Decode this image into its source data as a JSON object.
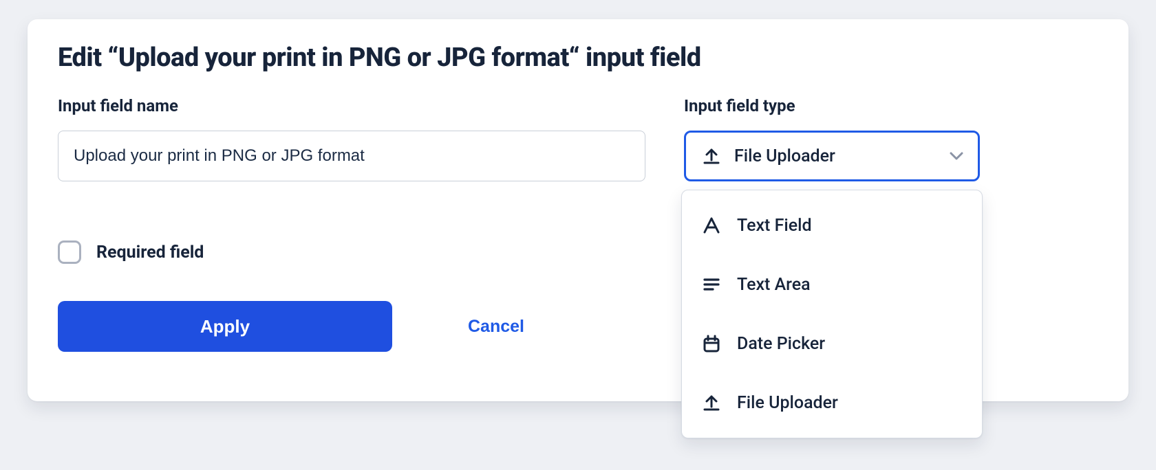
{
  "modal": {
    "title": "Edit “Upload your print in PNG or JPG format“ input field",
    "name_field": {
      "label": "Input field name",
      "value": "Upload your print in PNG or JPG format"
    },
    "type_field": {
      "label": "Input field type",
      "selected_icon": "upload-icon",
      "selected_label": "File Uploader",
      "options": [
        {
          "icon": "text-a-icon",
          "label": "Text Field"
        },
        {
          "icon": "text-lines-icon",
          "label": "Text Area"
        },
        {
          "icon": "calendar-icon",
          "label": "Date Picker"
        },
        {
          "icon": "upload-icon",
          "label": "File Uploader"
        }
      ]
    },
    "required": {
      "label": "Required field",
      "checked": false
    },
    "actions": {
      "apply": "Apply",
      "cancel": "Cancel"
    }
  }
}
